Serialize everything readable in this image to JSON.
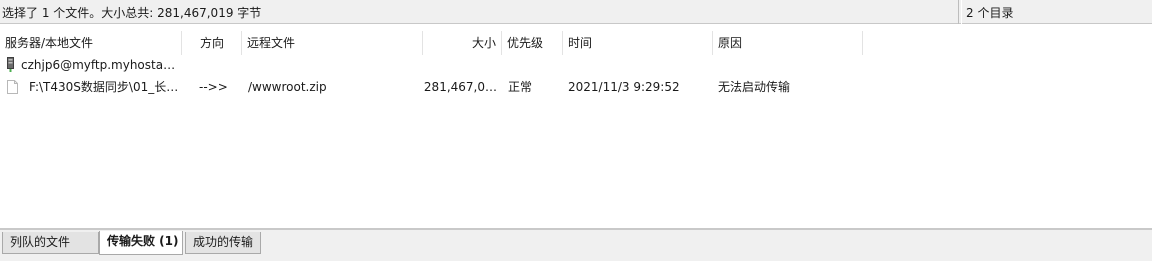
{
  "statusbar": {
    "selection": "选择了 1 个文件。大小总共: 281,467,019 字节",
    "dirs": "2 个目录"
  },
  "columns": {
    "local": "服务器/本地文件",
    "direction": "方向",
    "remote": "远程文件",
    "size": "大小",
    "priority": "优先级",
    "time": "时间",
    "reason": "原因"
  },
  "queue": {
    "server": "czhjp6@myftp.myhostad…",
    "item": {
      "local": "F:\\T430S数据同步\\01_长…",
      "direction": "-->>",
      "remote": "/wwwroot.zip",
      "size": "281,467,0…",
      "priority": "正常",
      "time": "2021/11/3 9:29:52",
      "reason": "无法启动传输"
    }
  },
  "tabs": [
    "列队的文件",
    "传输失败 (1)",
    "成功的传输"
  ],
  "colors": {
    "status_bg": "#f0f0f0",
    "tab_bg": "#e3e3e3"
  }
}
